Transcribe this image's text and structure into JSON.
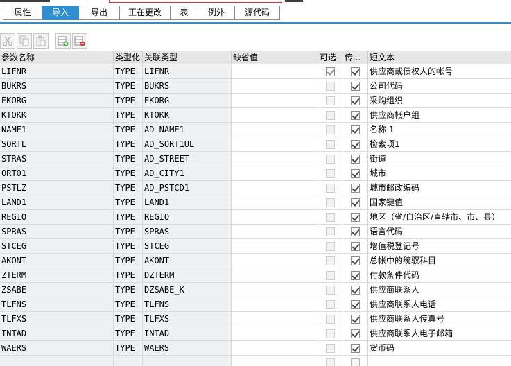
{
  "tabs": [
    {
      "label": "属性",
      "active": false
    },
    {
      "label": "导入",
      "active": true
    },
    {
      "label": "导出",
      "active": false
    },
    {
      "label": "正在更改",
      "active": false
    },
    {
      "label": "表",
      "active": false
    },
    {
      "label": "例外",
      "active": false
    },
    {
      "label": "源代码",
      "active": false
    }
  ],
  "toolbar": [
    {
      "icon": "cut-icon",
      "enabled": false
    },
    {
      "icon": "copy-icon",
      "enabled": false
    },
    {
      "icon": "paste-icon",
      "enabled": false
    },
    {
      "icon": "insert-row-icon",
      "enabled": true
    },
    {
      "icon": "delete-row-icon",
      "enabled": true
    }
  ],
  "columns": {
    "param": "参数名称",
    "typing": "类型化",
    "ref_type": "关联类型",
    "default": "缺省值",
    "optional": "可选",
    "pass_value": "传...",
    "short_text": "短文本"
  },
  "rows": [
    {
      "param": "LIFNR",
      "typing": "TYPE",
      "ref_type": "LIFNR",
      "optional": true,
      "pass_value": true,
      "short_text": "供应商或债权人的帐号"
    },
    {
      "param": "BUKRS",
      "typing": "TYPE",
      "ref_type": "BUKRS",
      "optional": false,
      "pass_value": true,
      "short_text": "公司代码"
    },
    {
      "param": "EKORG",
      "typing": "TYPE",
      "ref_type": "EKORG",
      "optional": false,
      "pass_value": true,
      "short_text": "采购组织"
    },
    {
      "param": "KTOKK",
      "typing": "TYPE",
      "ref_type": "KTOKK",
      "optional": false,
      "pass_value": true,
      "short_text": "供应商帐户组"
    },
    {
      "param": "NAME1",
      "typing": "TYPE",
      "ref_type": "AD_NAME1",
      "optional": false,
      "pass_value": true,
      "short_text": "名称 1"
    },
    {
      "param": "SORTL",
      "typing": "TYPE",
      "ref_type": "AD_SORT1UL",
      "optional": false,
      "pass_value": true,
      "short_text": "检索项1"
    },
    {
      "param": "STRAS",
      "typing": "TYPE",
      "ref_type": "AD_STREET",
      "optional": false,
      "pass_value": true,
      "short_text": "街道"
    },
    {
      "param": "ORT01",
      "typing": "TYPE",
      "ref_type": "AD_CITY1",
      "optional": false,
      "pass_value": true,
      "short_text": "城市"
    },
    {
      "param": "PSTLZ",
      "typing": "TYPE",
      "ref_type": "AD_PSTCD1",
      "optional": false,
      "pass_value": true,
      "short_text": "城市邮政编码"
    },
    {
      "param": "LAND1",
      "typing": "TYPE",
      "ref_type": "LAND1",
      "optional": false,
      "pass_value": true,
      "short_text": "国家键值"
    },
    {
      "param": "REGIO",
      "typing": "TYPE",
      "ref_type": "REGIO",
      "optional": false,
      "pass_value": true,
      "short_text": "地区（省/自治区/直辖市、市、县）"
    },
    {
      "param": "SPRAS",
      "typing": "TYPE",
      "ref_type": "SPRAS",
      "optional": false,
      "pass_value": true,
      "short_text": "语言代码"
    },
    {
      "param": "STCEG",
      "typing": "TYPE",
      "ref_type": "STCEG",
      "optional": false,
      "pass_value": true,
      "short_text": "增值税登记号"
    },
    {
      "param": "AKONT",
      "typing": "TYPE",
      "ref_type": "AKONT",
      "optional": false,
      "pass_value": true,
      "short_text": "总帐中的统驭科目"
    },
    {
      "param": "ZTERM",
      "typing": "TYPE",
      "ref_type": "DZTERM",
      "optional": false,
      "pass_value": true,
      "short_text": "付款条件代码"
    },
    {
      "param": "ZSABE",
      "typing": "TYPE",
      "ref_type": "DZSABE_K",
      "optional": false,
      "pass_value": true,
      "short_text": "供应商联系人"
    },
    {
      "param": "TLFNS",
      "typing": "TYPE",
      "ref_type": "TLFNS",
      "optional": false,
      "pass_value": true,
      "short_text": "供应商联系人电话"
    },
    {
      "param": "TLFXS",
      "typing": "TYPE",
      "ref_type": "TLFXS",
      "optional": false,
      "pass_value": true,
      "short_text": "供应商联系人传真号"
    },
    {
      "param": "INTAD",
      "typing": "TYPE",
      "ref_type": "INTAD",
      "optional": false,
      "pass_value": true,
      "short_text": "供应商联系人电子邮箱"
    },
    {
      "param": "WAERS",
      "typing": "TYPE",
      "ref_type": "WAERS",
      "optional": false,
      "pass_value": true,
      "short_text": "货币码"
    },
    {
      "param": "",
      "typing": "",
      "ref_type": "",
      "optional": false,
      "pass_value": false,
      "short_text": "",
      "empty": true
    }
  ]
}
